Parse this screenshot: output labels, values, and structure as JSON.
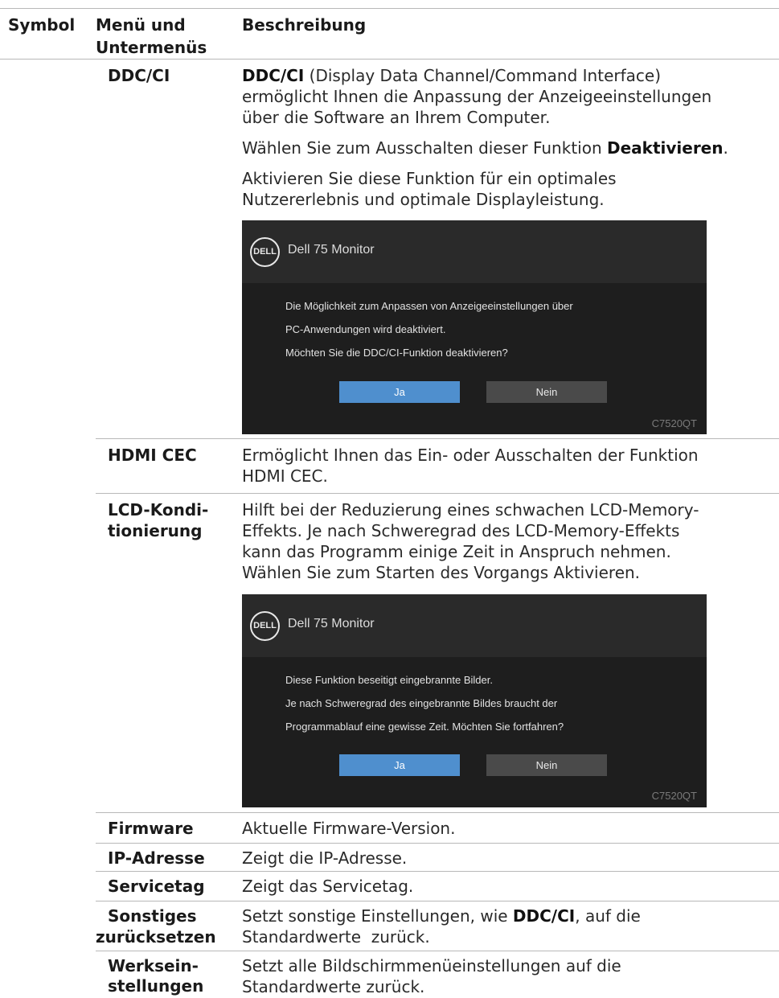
{
  "headers": {
    "symbol": "Symbol",
    "menu_line1": "Menü und",
    "menu_line2": "Untermenüs",
    "description": "Beschreibung"
  },
  "rows": {
    "ddcci": {
      "term": "DDC/CI",
      "p1_bold": "DDC/CI",
      "p1_rest1": " (Display Data Channel/Command Interface)",
      "p1_line2": "ermöglicht Ihnen die Anpassung der Anzeigeeinstellungen",
      "p1_line3": "über die Software an Ihrem Computer.",
      "p2_pre": "Wählen Sie zum Ausschalten dieser Funktion ",
      "p2_bold": "Deaktivieren",
      "p2_post": ".",
      "p3_line1": "Aktivieren Sie diese Funktion für ein optimales",
      "p3_line2": "Nutzererlebnis und optimale Displayleistung.",
      "dialog": {
        "logo": "DELL",
        "title": "Dell 75 Monitor",
        "lines": [
          "Die Möglichkeit zum Anpassen von Anzeigeeinstellungen über",
          "PC-Anwendungen wird deaktiviert.",
          "Möchten Sie die DDC/CI-Funktion deaktivieren?"
        ],
        "yes": "Ja",
        "no": "Nein",
        "model": "C7520QT"
      }
    },
    "hdmicec": {
      "term": "HDMI CEC",
      "line1": "Ermöglicht Ihnen das Ein- oder Ausschalten der Funktion",
      "line2": "HDMI CEC."
    },
    "lcd": {
      "term1": "LCD-Kondi-",
      "term2": "tionierung",
      "line1": "Hilft bei der Reduzierung eines schwachen LCD-Memory-",
      "line2": "Effekts. Je nach Schweregrad des LCD-Memory-Effekts",
      "line3": "kann das Programm einige Zeit in Anspruch nehmen.",
      "line4": "Wählen Sie zum Starten des Vorgangs Aktivieren.",
      "dialog": {
        "logo": "DELL",
        "title": "Dell 75 Monitor",
        "lines": [
          "Diese Funktion beseitigt eingebrannte Bilder.",
          "Je nach Schweregrad des eingebrannte Bildes braucht der",
          "Programmablauf eine gewisse Zeit. Möchten Sie fortfahren?"
        ],
        "yes": "Ja",
        "no": "Nein",
        "model": "C7520QT"
      }
    },
    "firmware": {
      "term": "Firmware",
      "desc": "Aktuelle Firmware-Version."
    },
    "ip": {
      "term": "IP-Adresse",
      "desc": "Zeigt die IP-Adresse."
    },
    "servicetag": {
      "term": "Servicetag",
      "desc": "Zeigt das Servicetag."
    },
    "other_reset": {
      "term1": "Sonstiges",
      "term2": "zurücksetzen",
      "desc1_pre": "Setzt sonstige Einstellungen, wie ",
      "desc1_bold": "DDC/CI",
      "desc1_post": ", auf die",
      "desc2": "Standardwerte  zurück."
    },
    "factory_reset": {
      "term1": "Werksein-",
      "term2": "stellungen",
      "desc1": "Setzt alle Bildschirmmenüeinstellungen auf die",
      "desc2": "Standardwerte zurück."
    }
  }
}
